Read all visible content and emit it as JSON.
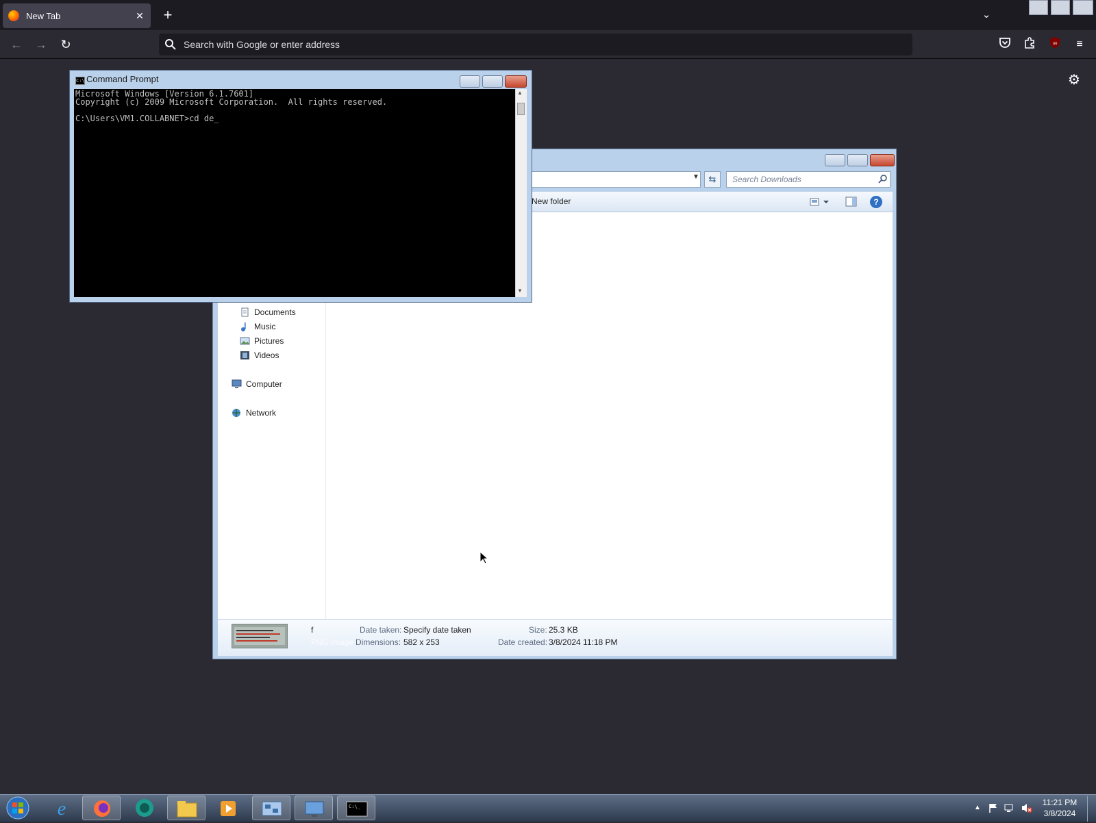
{
  "browser": {
    "tab": {
      "title": "New Tab",
      "close_glyph": "✕"
    },
    "new_tab_glyph": "+",
    "url_placeholder": "Search with Google or enter address"
  },
  "cmd": {
    "title": "Command Prompt",
    "lines": [
      "Microsoft Windows [Version 6.1.7601]",
      "Copyright (c) 2009 Microsoft Corporation.  All rights reserved.",
      "",
      "C:\\Users\\VM1.COLLABNET>cd de_"
    ]
  },
  "explorer": {
    "search_placeholder": "Search Downloads",
    "new_folder_label": "New folder",
    "nav": {
      "documents": "Documents",
      "music": "Music",
      "pictures": "Pictures",
      "videos": "Videos",
      "computer": "Computer",
      "network": "Network"
    },
    "details": {
      "file_name": "f",
      "file_type": "PNG image",
      "date_taken_label": "Date taken:",
      "date_taken_value": "Specify date taken",
      "dimensions_label": "Dimensions:",
      "dimensions_value": "582 x 253",
      "size_label": "Size:",
      "size_value": "25.3 KB",
      "date_created_label": "Date created:",
      "date_created_value": "3/8/2024 11:18 PM"
    }
  },
  "taskbar": {
    "time": "11:21 PM",
    "date": "3/8/2024"
  },
  "colors": {
    "browser_bg": "#2b2a33",
    "cmd_bg": "#000000",
    "explorer_frame": "#b9d1ea"
  }
}
